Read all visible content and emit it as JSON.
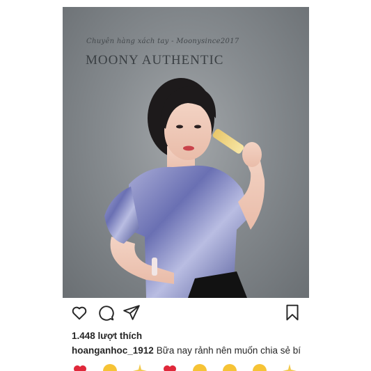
{
  "post": {
    "watermark_script": "Chuyên hàng xách tay - Moonysince2017",
    "watermark_title": "MOONY AUTHENTIC",
    "likes_text": "1.448 lượt thích",
    "username": "hoanganhoc_1912",
    "caption": "Bữa nay rảnh nên muốn chia sẻ bí"
  },
  "icons": {
    "like": "heart-icon",
    "comment": "comment-icon",
    "share": "send-icon",
    "save": "bookmark-icon"
  },
  "emoji_row": [
    "heart",
    "smiley",
    "sparkle",
    "heart",
    "smiley",
    "smiley",
    "smiley",
    "sparkle"
  ],
  "colors": {
    "text": "#262626",
    "icon": "#262626",
    "background": "#ffffff"
  }
}
